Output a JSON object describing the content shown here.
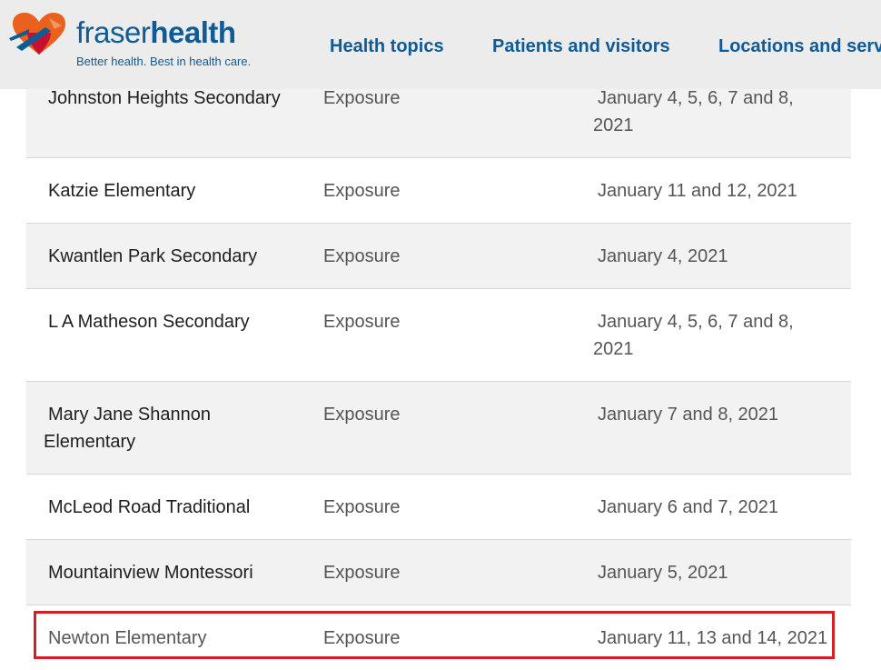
{
  "header": {
    "logo": {
      "word_regular": "fraser",
      "word_bold": "health",
      "tagline": "Better health. Best in health care.",
      "icon": "heart-logo-icon",
      "colors": {
        "brand_blue": "#0e5b96",
        "orange": "#e9611d",
        "red": "#c8102e"
      }
    },
    "nav": [
      "Health topics",
      "Patients and visitors",
      "Locations and serv"
    ]
  },
  "table": {
    "rows": [
      {
        "school": "Johnston Heights Secondary",
        "type": "Exposure",
        "dates": "January 4, 5, 6, 7 and 8, 2021"
      },
      {
        "school": "Katzie Elementary",
        "type": "Exposure",
        "dates": "January 11 and 12, 2021"
      },
      {
        "school": "Kwantlen Park Secondary",
        "type": "Exposure",
        "dates": "January 4, 2021"
      },
      {
        "school": "L A Matheson Secondary",
        "type": "Exposure",
        "dates": "January 4, 5, 6, 7 and 8, 2021"
      },
      {
        "school": "Mary Jane Shannon Elementary",
        "type": "Exposure",
        "dates": "January 7 and 8, 2021"
      },
      {
        "school": "McLeod Road Traditional",
        "type": "Exposure",
        "dates": "January 6 and 7, 2021"
      },
      {
        "school": "Mountainview Montessori",
        "type": "Exposure",
        "dates": "January 5, 2021"
      },
      {
        "school": "Newton Elementary",
        "type": "Exposure",
        "dates": "January 11, 13 and 14, 2021"
      }
    ],
    "highlighted_row": "Newton Elementary",
    "highlight_color": "#d32027"
  }
}
